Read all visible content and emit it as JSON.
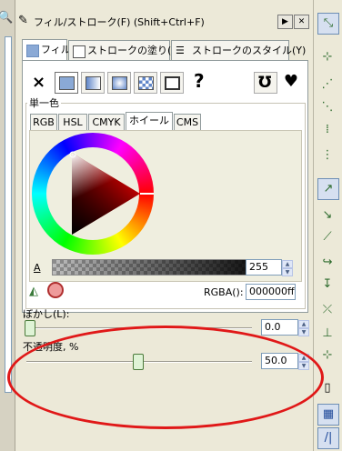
{
  "window": {
    "title": "フィル/ストローク(F) (Shift+Ctrl+F)"
  },
  "tabs": [
    {
      "label": "フィル"
    },
    {
      "label": "ストロークの塗り(P)"
    },
    {
      "label": "ストロークのスタイル(Y)"
    }
  ],
  "paint_types": [
    "×",
    "?"
  ],
  "flat_color_label": "単一色",
  "color_modes": [
    "RGB",
    "HSL",
    "CMYK",
    "ホイール",
    "CMS"
  ],
  "alpha": {
    "label": "A",
    "value": "255"
  },
  "rgba": {
    "label": "RGBA():",
    "value": "000000ff"
  },
  "blur": {
    "label": "ぼかし(L):",
    "value": "0.0",
    "level": 0.0
  },
  "opacity": {
    "label": "不透明度, %",
    "value": "50.0",
    "level": 0.5
  },
  "colors": {
    "annotation": "#e01818",
    "selected_fill": "#8aa9d6"
  },
  "right_toolbar": {
    "icons": [
      "snap-toggle-icon",
      "snap-node-icon",
      "snap-bbox-icon",
      "snap-edge-icon",
      "snap-midpoint-icon",
      "snap-center-icon",
      "snap-path-icon",
      "snap-intersection-icon",
      "snap-cusp-icon",
      "snap-smooth-icon",
      "snap-guide-icon",
      "snap-grid-icon",
      "snap-page-icon",
      "grid-icon",
      "guides-icon"
    ]
  }
}
